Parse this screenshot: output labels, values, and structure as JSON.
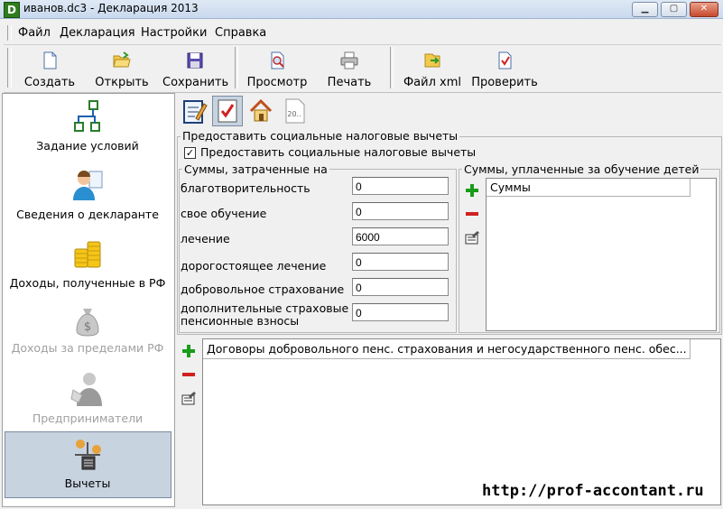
{
  "window": {
    "title": "иванов.dc3 - Декларация 2013",
    "app_icon_letter": "D"
  },
  "menu": [
    "Файл",
    "Декларация",
    "Настройки",
    "Справка"
  ],
  "toolbar": {
    "create": "Создать",
    "open": "Открыть",
    "save": "Сохранить",
    "preview": "Просмотр",
    "print": "Печать",
    "xml": "Файл xml",
    "check": "Проверить"
  },
  "sidebar": {
    "items": [
      {
        "label": "Задание условий",
        "icon": "flowchart-icon",
        "enabled": true
      },
      {
        "label": "Сведения о декларанте",
        "icon": "person-icon",
        "enabled": true
      },
      {
        "label": "Доходы, полученные в РФ",
        "icon": "coins-icon",
        "enabled": true
      },
      {
        "label": "Доходы за пределами РФ",
        "icon": "money-bag-icon",
        "enabled": false
      },
      {
        "label": "Предприниматели",
        "icon": "businessman-icon",
        "enabled": false
      },
      {
        "label": "Вычеты",
        "icon": "scales-calculator-icon",
        "enabled": true,
        "selected": true
      }
    ]
  },
  "tabs": [
    "standard-deductions-tab",
    "social-deductions-tab",
    "property-deductions-tab",
    "securities-tab"
  ],
  "tab_securities_text": "20..",
  "social": {
    "group_title": "Предоставить социальные налоговые вычеты",
    "checkbox_label": "Предоставить социальные налоговые вычеты",
    "checkbox_checked": true,
    "spent_title": "Суммы, затраченные на",
    "fields": [
      {
        "label": "благотворительность",
        "value": "0"
      },
      {
        "label": "свое обучение",
        "value": "0"
      },
      {
        "label": "лечение",
        "value": "6000"
      },
      {
        "label": "дорогостоящее лечение",
        "value": "0"
      },
      {
        "label": "добровольное страхование",
        "value": "0"
      },
      {
        "label_line1": "дополнительные страховые",
        "label_line2": "пенсионные взносы",
        "value": "0"
      }
    ],
    "children_title": "Суммы, уплаченные за обучение детей",
    "children_col": "Суммы"
  },
  "contracts": {
    "column": "Договоры добровольного пенс. страхования и негосударственного пенс. обес..."
  },
  "watermark": "http://prof-accontant.ru",
  "colors": {
    "selected_bg": "#c8d3e0",
    "add_green": "#1a9c1a",
    "remove_red": "#d02020"
  }
}
